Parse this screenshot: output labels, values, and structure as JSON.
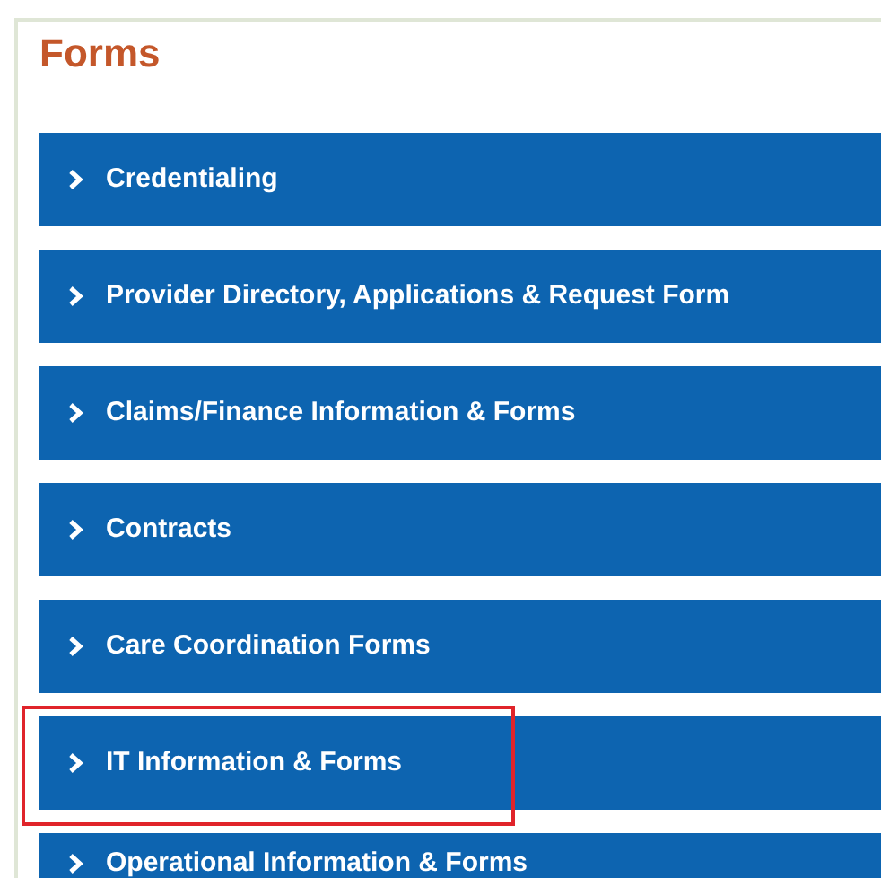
{
  "title": "Forms",
  "items": [
    {
      "label": "Credentialing",
      "highlighted": false
    },
    {
      "label": "Provider Directory, Applications & Request Form",
      "highlighted": false
    },
    {
      "label": "Claims/Finance Information & Forms",
      "highlighted": false
    },
    {
      "label": "Contracts",
      "highlighted": false
    },
    {
      "label": "Care Coordination Forms",
      "highlighted": false
    },
    {
      "label": "IT Information & Forms",
      "highlighted": true
    },
    {
      "label": "Operational Information & Forms",
      "highlighted": false
    }
  ]
}
